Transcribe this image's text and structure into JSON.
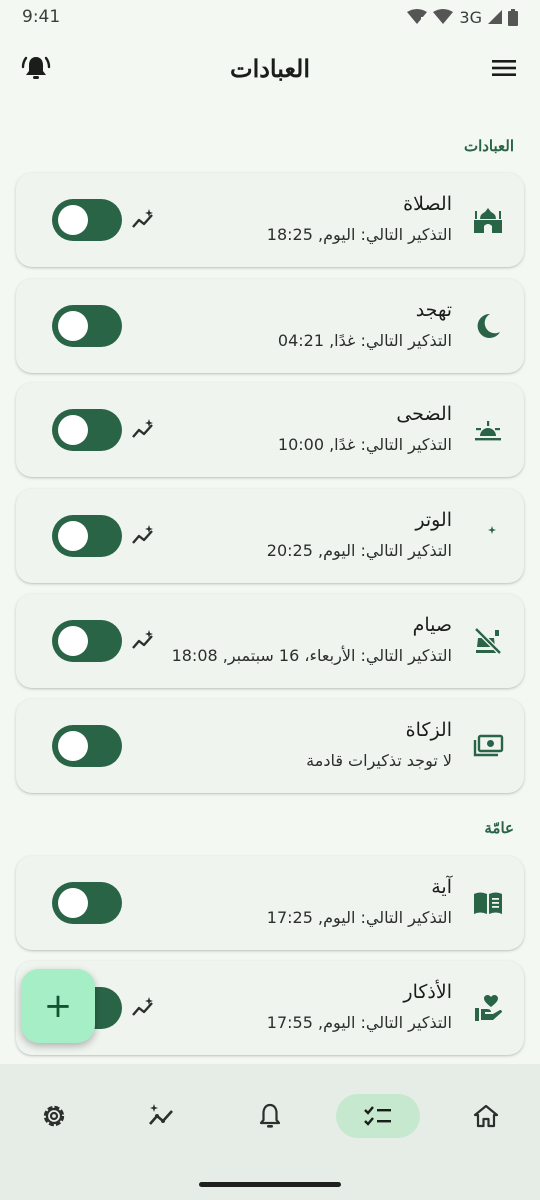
{
  "status_bar": {
    "time": "9:41",
    "network": "3G"
  },
  "app_bar": {
    "title": "العبادات"
  },
  "sections": [
    {
      "title": "العبادات"
    },
    {
      "title": "عامّة"
    }
  ],
  "cards": [
    {
      "title": "الصلاة",
      "subtitle": "التذكير التالي: اليوم, 18:25",
      "enabled": false
    },
    {
      "title": "تهجد",
      "subtitle": "التذكير التالي: غدًا, 04:21",
      "enabled": false
    },
    {
      "title": "الضحى",
      "subtitle": "التذكير التالي: غدًا, 10:00",
      "enabled": false
    },
    {
      "title": "الوتر",
      "subtitle": "التذكير التالي: اليوم, 20:25",
      "enabled": false
    },
    {
      "title": "صيام",
      "subtitle": "التذكير التالي: الأربعاء، 16 سبتمبر, 18:08",
      "enabled": false
    },
    {
      "title": "الزكاة",
      "subtitle": "لا توجد تذكيرات قادمة",
      "enabled": false
    },
    {
      "title": "آية",
      "subtitle": "التذكير التالي: اليوم, 17:25",
      "enabled": false
    },
    {
      "title": "الأذكار",
      "subtitle": "التذكير التالي: اليوم, 17:55",
      "enabled": false
    }
  ],
  "fab": {
    "label": "+"
  },
  "colors": {
    "accent": "#2a6447",
    "background": "#f3f8f3",
    "card": "#f0f4ef",
    "fab": "#a6eec5",
    "nav_active": "#c5e8cf"
  },
  "icons": {
    "cards": [
      "mosque-icon",
      "crescent-moon-icon",
      "sunrise-icon",
      "moon-stars-icon",
      "no-food-icon",
      "payments-icon",
      "book-icon",
      "hand-heart-icon"
    ],
    "nav": [
      "settings-icon",
      "stats-icon",
      "notifications-icon",
      "checklist-icon",
      "home-icon"
    ]
  }
}
